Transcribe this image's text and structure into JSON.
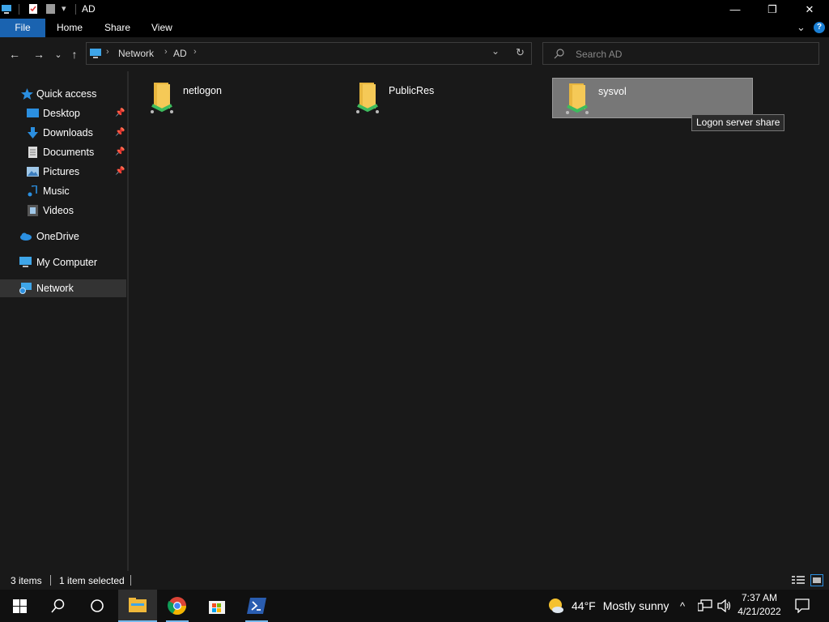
{
  "window": {
    "title": "AD",
    "controls": {
      "minimize": "—",
      "maximize": "❐",
      "close": "✕"
    }
  },
  "ribbon": {
    "tabs": [
      {
        "label": "File"
      },
      {
        "label": "Home"
      },
      {
        "label": "Share"
      },
      {
        "label": "View"
      }
    ],
    "help": "?"
  },
  "nav": {
    "back": "←",
    "forward": "→",
    "recent": "⌄",
    "up": "↑",
    "breadcrumb": [
      "Network",
      "AD"
    ],
    "dropdown": "⌄",
    "refresh": "↻",
    "search_placeholder": "Search AD"
  },
  "sidebar": {
    "quick_access": "Quick access",
    "items": [
      {
        "label": "Desktop",
        "icon": "desktop-icon",
        "pinned": true
      },
      {
        "label": "Downloads",
        "icon": "downloads-icon",
        "pinned": true
      },
      {
        "label": "Documents",
        "icon": "documents-icon",
        "pinned": true
      },
      {
        "label": "Pictures",
        "icon": "pictures-icon",
        "pinned": true
      },
      {
        "label": "Music",
        "icon": "music-icon",
        "pinned": false
      },
      {
        "label": "Videos",
        "icon": "videos-icon",
        "pinned": false
      }
    ],
    "onedrive": "OneDrive",
    "my_computer": "My Computer",
    "network": "Network"
  },
  "content": {
    "items": [
      {
        "name": "netlogon",
        "selected": false
      },
      {
        "name": "PublicRes",
        "selected": false
      },
      {
        "name": "sysvol",
        "selected": true
      }
    ],
    "tooltip": "Logon server share"
  },
  "status": {
    "item_count": "3 items",
    "selection": "1 item selected"
  },
  "taskbar": {
    "weather_temp": "44°F",
    "weather_desc": "Mostly sunny",
    "time": "7:37 AM",
    "date": "4/21/2022"
  },
  "colors": {
    "accent": "#1a63b0",
    "background": "#191919",
    "selection": "#777777",
    "share_green": "#3dbb5d",
    "folder_yellow": "#f5c957"
  }
}
